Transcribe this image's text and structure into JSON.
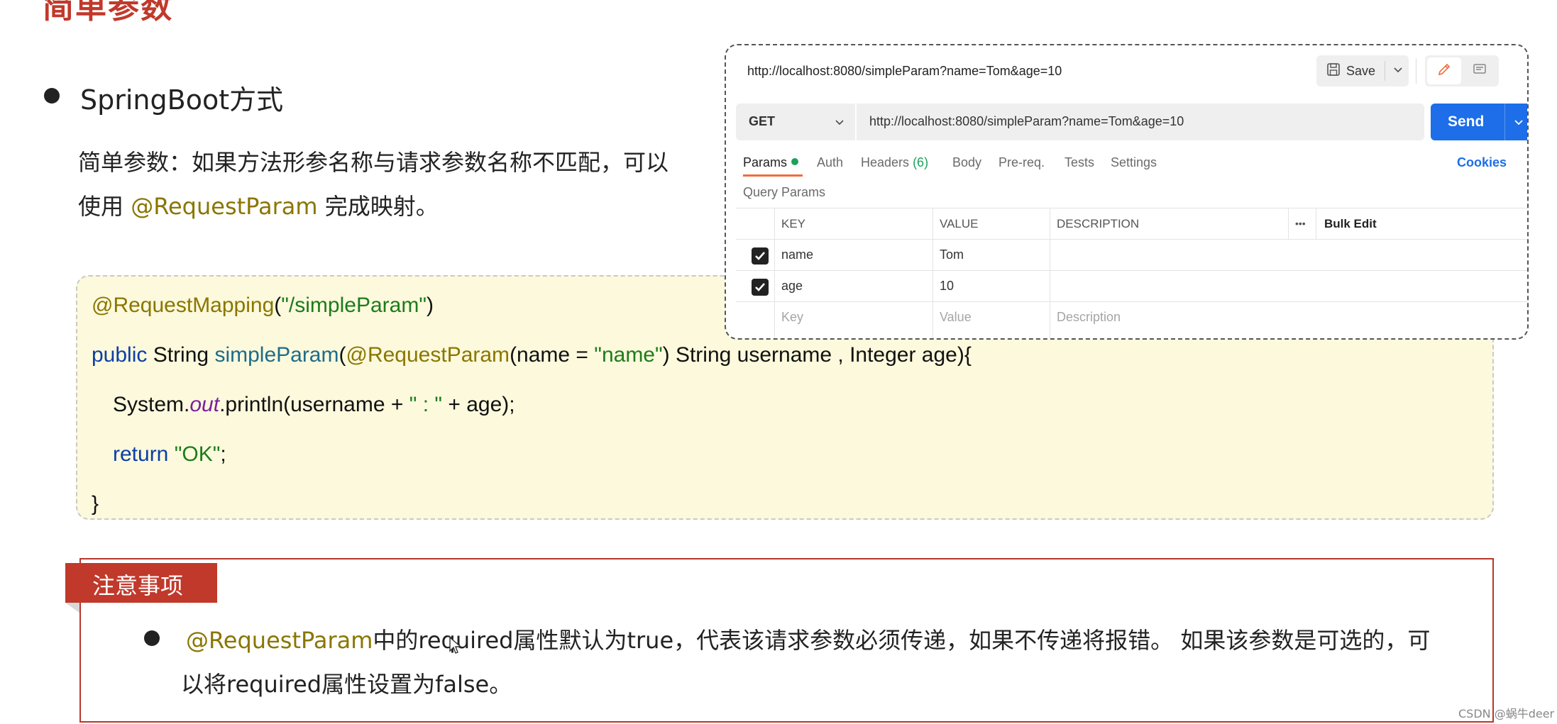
{
  "slide": {
    "title": "简单参数",
    "bullet": "SpringBoot方式",
    "desc_line1": "简单参数：如果方法形参名称与请求参数名称不匹配，可以",
    "desc_line2_pre": "使用 ",
    "desc_line2_anno": "@RequestParam",
    "desc_line2_post": " 完成映射。"
  },
  "code": {
    "line1_anno": "@RequestMapping",
    "line1_open": "(",
    "line1_str": "\"/simpleParam\"",
    "line1_close": ")",
    "line2_kw": "public",
    "line2_type": " String ",
    "line2_method": "simpleParam",
    "line2_open": "(",
    "line2_anno": "@RequestParam",
    "line2_mid": "(name = ",
    "line2_str": "\"name\"",
    "line2_rest": ") String username , Integer age){",
    "line3_pre": "System.",
    "line3_field": "out",
    "line3_mid": ".println(username + ",
    "line3_str": "\" : \"",
    "line3_rest": " + age);",
    "line4_kw": "return",
    "line4_sp": " ",
    "line4_str": "\"OK\"",
    "line4_rest": ";",
    "line5": "}"
  },
  "postman": {
    "title_url": "http://localhost:8080/simpleParam?name=Tom&age=10",
    "save_label": "Save",
    "method": "GET",
    "url": "http://localhost:8080/simpleParam?name=Tom&age=10",
    "send_label": "Send",
    "tabs": {
      "params": "Params",
      "auth": "Auth",
      "headers": "Headers",
      "headers_count": "(6)",
      "body": "Body",
      "prereq": "Pre-req.",
      "tests": "Tests",
      "settings": "Settings"
    },
    "cookies": "Cookies",
    "query_params_label": "Query Params",
    "columns": {
      "key": "KEY",
      "value": "VALUE",
      "description": "DESCRIPTION",
      "more": "•••",
      "bulk_edit": "Bulk Edit"
    },
    "rows": [
      {
        "key": "name",
        "value": "Tom",
        "checked": true
      },
      {
        "key": "age",
        "value": "10",
        "checked": true
      }
    ],
    "placeholder": {
      "key": "Key",
      "value": "Value",
      "description": "Description"
    }
  },
  "notice": {
    "tag": "注意事项",
    "anno": "@RequestParam",
    "line1_rest": "中的required属性默认为true，代表该请求参数必须传递，如果不传递将报错。 如果该参数是可选的，可",
    "line2": "以将required属性设置为false。"
  },
  "watermark": "CSDN @蜗牛deer",
  "colors": {
    "title_red": "#c0392b",
    "annotation_olive": "#8a7600",
    "send_blue": "#1d6ee8",
    "code_bg": "#fcf9dc"
  }
}
